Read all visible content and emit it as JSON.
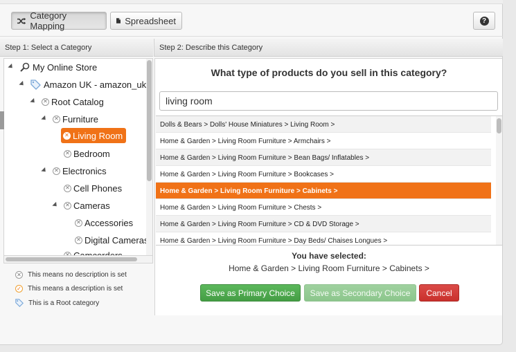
{
  "toolbar": {
    "category_mapping_label": "Category Mapping",
    "spreadsheet_label": "Spreadsheet",
    "help_label": "?"
  },
  "step1": {
    "header": "Step 1: Select a Category",
    "tree": {
      "root": "My Online Store",
      "store": "Amazon UK - amazon_uk",
      "catalog": "Root Catalog",
      "furniture": "Furniture",
      "living_room": "Living Room",
      "bedroom": "Bedroom",
      "electronics": "Electronics",
      "cell_phones": "Cell Phones",
      "cameras": "Cameras",
      "accessories": "Accessories",
      "digital_cameras": "Digital Cameras",
      "cut_off": "Camcorders"
    },
    "legend": {
      "no_description": "This means no description is set",
      "description_set": "This means a description is set",
      "root_category": "This is a Root category"
    }
  },
  "step2": {
    "header": "Step 2: Describe this Category",
    "question": "What type of products do you sell in this category?",
    "search_value": "living room",
    "results": [
      "Dolls & Bears > Dolls' House Miniatures > Living Room >",
      "Home & Garden > Living Room Furniture > Armchairs >",
      "Home & Garden > Living Room Furniture > Bean Bags/ Inflatables >",
      "Home & Garden > Living Room Furniture > Bookcases >",
      "Home & Garden > Living Room Furniture > Cabinets >",
      "Home & Garden > Living Room Furniture > Chests >",
      "Home & Garden > Living Room Furniture > CD & DVD Storage >",
      "Home & Garden > Living Room Furniture > Day Beds/ Chaises Longues >"
    ],
    "selected_index": 4,
    "selected_title": "You have selected:",
    "selected_path": "Home & Garden > Living Room Furniture > Cabinets >",
    "buttons": {
      "primary": "Save as Primary Choice",
      "secondary": "Save as Secondary Choice",
      "cancel": "Cancel"
    }
  },
  "colors": {
    "accent": "#f07217",
    "primary_button": "#449d44",
    "cancel_button": "#c9302c"
  }
}
